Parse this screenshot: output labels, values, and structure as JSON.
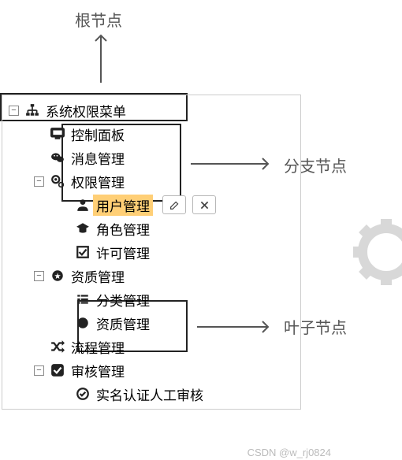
{
  "annotations": {
    "root": "根节点",
    "branch": "分支节点",
    "leaf": "叶子节点"
  },
  "tree": {
    "root": {
      "label": "系统权限菜单"
    },
    "control_panel": {
      "label": "控制面板"
    },
    "message_mgmt": {
      "label": "消息管理"
    },
    "permission_mgmt": {
      "label": "权限管理"
    },
    "user_mgmt": {
      "label": "用户管理"
    },
    "role_mgmt": {
      "label": "角色管理"
    },
    "license_mgmt": {
      "label": "许可管理"
    },
    "qualification_mgmt": {
      "label": "资质管理"
    },
    "category_mgmt": {
      "label": "分类管理"
    },
    "qualification_item": {
      "label": "资质管理"
    },
    "process_mgmt": {
      "label": "流程管理"
    },
    "audit_mgmt": {
      "label": "审核管理"
    },
    "realname_audit": {
      "label": "实名认证人工审核"
    }
  },
  "credit": "CSDN @w_rj0824"
}
